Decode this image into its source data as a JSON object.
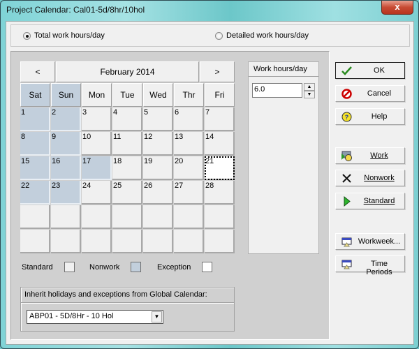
{
  "window": {
    "title": "Project Calendar: Cal01-5d/8hr/10hol",
    "close_label": "x"
  },
  "mode": {
    "options": [
      {
        "label": "Total work hours/day",
        "selected": true
      },
      {
        "label": "Detailed work hours/day",
        "selected": false
      }
    ]
  },
  "calendar": {
    "prev_label": "<",
    "next_label": ">",
    "month_label": "February 2014",
    "weekdays": [
      {
        "label": "Sat",
        "type": "nonwork"
      },
      {
        "label": "Sun",
        "type": "nonwork"
      },
      {
        "label": "Mon",
        "type": "standard"
      },
      {
        "label": "Tue",
        "type": "standard"
      },
      {
        "label": "Wed",
        "type": "standard"
      },
      {
        "label": "Thr",
        "type": "standard"
      },
      {
        "label": "Fri",
        "type": "standard"
      }
    ],
    "days": [
      {
        "label": "1",
        "type": "nonwork"
      },
      {
        "label": "2",
        "type": "nonwork"
      },
      {
        "label": "3",
        "type": "standard"
      },
      {
        "label": "4",
        "type": "standard"
      },
      {
        "label": "5",
        "type": "standard"
      },
      {
        "label": "6",
        "type": "standard"
      },
      {
        "label": "7",
        "type": "standard"
      },
      {
        "label": "8",
        "type": "nonwork"
      },
      {
        "label": "9",
        "type": "nonwork"
      },
      {
        "label": "10",
        "type": "standard"
      },
      {
        "label": "11",
        "type": "standard"
      },
      {
        "label": "12",
        "type": "standard"
      },
      {
        "label": "13",
        "type": "standard"
      },
      {
        "label": "14",
        "type": "standard"
      },
      {
        "label": "15",
        "type": "nonwork"
      },
      {
        "label": "16",
        "type": "nonwork"
      },
      {
        "label": "17",
        "type": "nonwork"
      },
      {
        "label": "18",
        "type": "standard"
      },
      {
        "label": "19",
        "type": "standard"
      },
      {
        "label": "20",
        "type": "standard"
      },
      {
        "label": "21",
        "type": "selected"
      },
      {
        "label": "22",
        "type": "nonwork"
      },
      {
        "label": "23",
        "type": "nonwork"
      },
      {
        "label": "24",
        "type": "standard"
      },
      {
        "label": "25",
        "type": "standard"
      },
      {
        "label": "26",
        "type": "standard"
      },
      {
        "label": "27",
        "type": "standard"
      },
      {
        "label": "28",
        "type": "standard"
      },
      {
        "label": "",
        "type": "standard"
      },
      {
        "label": "",
        "type": "standard"
      },
      {
        "label": "",
        "type": "standard"
      },
      {
        "label": "",
        "type": "standard"
      },
      {
        "label": "",
        "type": "standard"
      },
      {
        "label": "",
        "type": "standard"
      },
      {
        "label": "",
        "type": "standard"
      },
      {
        "label": "",
        "type": "standard"
      },
      {
        "label": "",
        "type": "standard"
      },
      {
        "label": "",
        "type": "standard"
      },
      {
        "label": "",
        "type": "standard"
      },
      {
        "label": "",
        "type": "standard"
      },
      {
        "label": "",
        "type": "standard"
      },
      {
        "label": "",
        "type": "standard"
      }
    ]
  },
  "work_hours": {
    "header": "Work hours/day",
    "value": "6.0"
  },
  "legend": {
    "standard": "Standard",
    "nonwork": "Nonwork",
    "exception": "Exception",
    "colors": {
      "standard": "#f0f0f0",
      "nonwork": "#c2cfdc",
      "exception": "#ffffff"
    }
  },
  "inherit": {
    "label": "Inherit holidays and exceptions from Global Calendar:",
    "selected": "ABP01 - 5D/8Hr - 10 Hol"
  },
  "buttons": {
    "ok": "OK",
    "cancel": "Cancel",
    "help": "Help",
    "work": "Work",
    "nonwork": "Nonwork",
    "standard": "Standard",
    "workweek": "Workweek...",
    "time_periods": "Time Periods"
  }
}
